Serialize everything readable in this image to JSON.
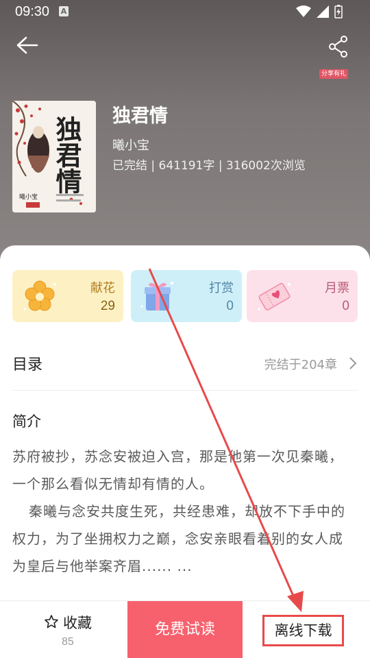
{
  "status_bar": {
    "time": "09:30",
    "app_badge": "A"
  },
  "header": {
    "share_tag": "分享有礼"
  },
  "book": {
    "title": "独君情",
    "author": "曦小宝",
    "meta": "已完结 | 641191字 | 316002次浏览",
    "cover": {
      "calligraphy": "独君情",
      "author": "曦小宝"
    }
  },
  "stats": [
    {
      "label": "献花",
      "value": "29",
      "icon": "flower-icon"
    },
    {
      "label": "打赏",
      "value": "0",
      "icon": "gift-icon"
    },
    {
      "label": "月票",
      "value": "0",
      "icon": "ticket-icon"
    }
  ],
  "toc": {
    "title": "目录",
    "status": "完结于204章"
  },
  "intro": {
    "title": "简介",
    "paragraph_1": "苏府被抄，苏念安被迫入宫，那是他第一次见秦曦，一个那么看似无情却有情的人。",
    "paragraph_2": "秦曦与念安共度生死，共经患难，却放不下手中的权力，为了坐拥权力之巅，念安亲眼看着别的女人成为皇后与他举案齐眉...... ..."
  },
  "bottom_bar": {
    "favorite_label": "收藏",
    "favorite_count": "85",
    "read_label": "免费试读",
    "download_label": "离线下载"
  },
  "colors": {
    "accent": "#f7606d",
    "annotation": "#e84a4a"
  }
}
